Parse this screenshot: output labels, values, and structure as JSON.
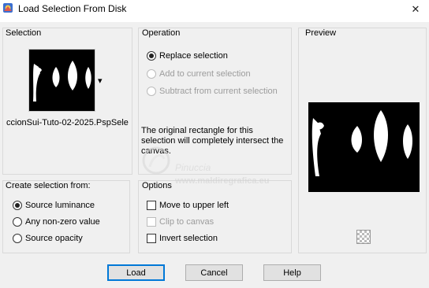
{
  "window": {
    "title": "Load Selection From Disk",
    "close_glyph": "✕"
  },
  "selection": {
    "label": "Selection",
    "filename": "ccionSui-Tuto-02-2025.PspSele",
    "dropdown_glyph": "▾"
  },
  "operation": {
    "label": "Operation",
    "options": [
      {
        "label": "Replace selection",
        "checked": true,
        "enabled": true
      },
      {
        "label": "Add to current selection",
        "checked": false,
        "enabled": false
      },
      {
        "label": "Subtract from current selection",
        "checked": false,
        "enabled": false
      }
    ],
    "info": "The original rectangle for this selection will completely intersect the canvas."
  },
  "preview": {
    "label": "Preview"
  },
  "create_from": {
    "label": "Create selection from:",
    "options": [
      {
        "label": "Source luminance",
        "checked": true
      },
      {
        "label": "Any non-zero value",
        "checked": false
      },
      {
        "label": "Source opacity",
        "checked": false
      }
    ]
  },
  "options": {
    "label": "Options",
    "items": [
      {
        "label": "Move to upper left",
        "checked": false,
        "enabled": true
      },
      {
        "label": "Clip to canvas",
        "checked": false,
        "enabled": false
      },
      {
        "label": "Invert selection",
        "checked": false,
        "enabled": true
      }
    ]
  },
  "buttons": {
    "load": "Load",
    "cancel": "Cancel",
    "help": "Help"
  },
  "watermark": {
    "name": "Pinuccia",
    "site": "www.maldiregrafica.eu"
  },
  "colors": {
    "accent": "#0078d7",
    "panel": "#f0f0f0",
    "border": "#d9d9d9"
  }
}
